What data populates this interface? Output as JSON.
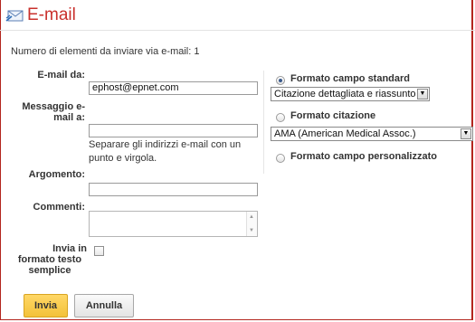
{
  "header": {
    "title": "E-mail",
    "icon": "email-send-icon"
  },
  "count_text": "Numero di elementi da inviare via e-mail: 1",
  "form": {
    "from_label": "E-mail da:",
    "from_value": "ephost@epnet.com",
    "to_label_line1": "Messaggio e-",
    "to_label_line2": "mail a:",
    "to_value": "",
    "to_hint": "Separare gli indirizzi e-mail con un punto e virgola.",
    "subject_label": "Argomento:",
    "subject_value": "",
    "comments_label": "Commenti:",
    "comments_value": "",
    "plain_label_line1": "Invia in",
    "plain_label_line2": "formato testo",
    "plain_label_line3": "semplice",
    "plain_checked": false
  },
  "format": {
    "standard_label": "Formato campo standard",
    "standard_selected": true,
    "standard_select_value": "Citazione dettagliata e riassunto",
    "citation_label": "Formato citazione",
    "citation_select_value": "AMA (American Medical Assoc.)",
    "custom_label": "Formato campo personalizzato"
  },
  "buttons": {
    "send": "Invia",
    "cancel": "Annulla"
  },
  "colors": {
    "title": "#c9302c",
    "border": "#b3261e",
    "send_button": "#f3c23a"
  }
}
